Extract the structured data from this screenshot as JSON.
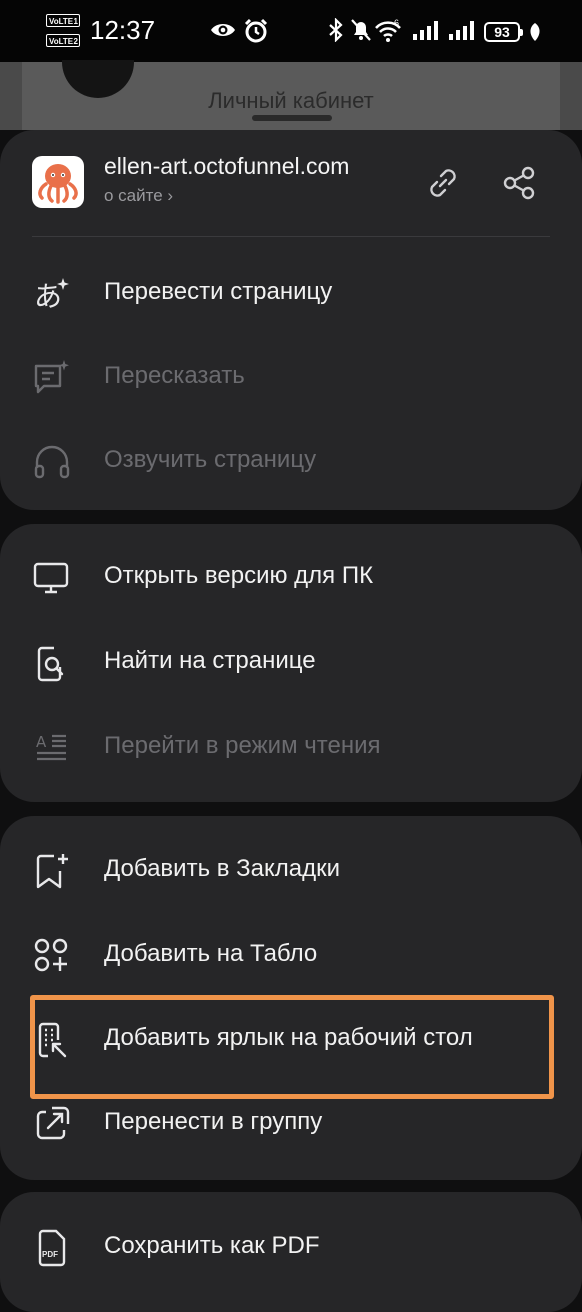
{
  "status_bar": {
    "time": "12:37",
    "volte1": "VoLTE",
    "volte1_sim": "1",
    "volte2": "VoLTE",
    "volte2_sim": "2",
    "battery": "93",
    "wifi_badge": "6"
  },
  "background_page": {
    "label": "Личный кабинет"
  },
  "site": {
    "title": "ellen-art.octofunnel.com",
    "subtitle": "о сайте ›",
    "icon": "octopus-logo",
    "accent": "#e9704a"
  },
  "menu": {
    "group1": [
      {
        "label": "Перевести страницу",
        "icon": "translate-icon",
        "enabled": true
      },
      {
        "label": "Пересказать",
        "icon": "summary-icon",
        "enabled": false
      },
      {
        "label": "Озвучить страницу",
        "icon": "headphones-icon",
        "enabled": false
      }
    ],
    "group2": [
      {
        "label": "Открыть версию для ПК",
        "icon": "monitor-icon",
        "enabled": true
      },
      {
        "label": "Найти на странице",
        "icon": "find-in-page-icon",
        "enabled": true
      },
      {
        "label": "Перейти в режим чтения",
        "icon": "reader-mode-icon",
        "enabled": false
      }
    ],
    "group3": [
      {
        "label": "Добавить в Закладки",
        "icon": "bookmark-add-icon",
        "enabled": true
      },
      {
        "label": "Добавить на Табло",
        "icon": "dashboard-add-icon",
        "enabled": true
      },
      {
        "label": "Добавить ярлык на рабочий стол",
        "icon": "shortcut-add-icon",
        "enabled": true,
        "highlighted": true
      },
      {
        "label": "Перенести в группу",
        "icon": "move-to-group-icon",
        "enabled": true
      }
    ],
    "group4": [
      {
        "label": "Сохранить как PDF",
        "icon": "pdf-icon",
        "enabled": true,
        "icon_text": "PDF"
      }
    ]
  },
  "colors": {
    "sheet_bg": "#0f0f10",
    "card_bg": "#262628",
    "highlight": "#f0944a",
    "disabled_text": "#6b6b6f"
  }
}
